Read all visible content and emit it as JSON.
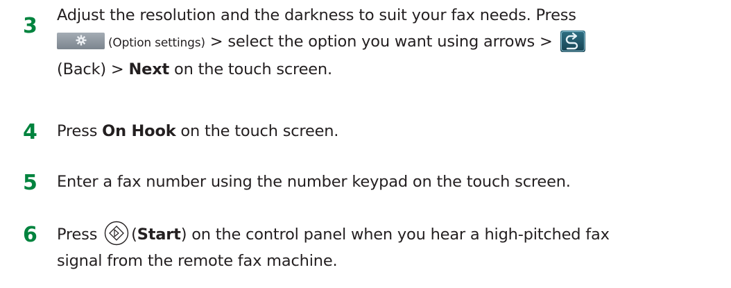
{
  "steps": [
    {
      "number": "3",
      "line1": "Adjust the resolution and the darkness to suit your fax needs. Press",
      "option_label": "(Option settings)",
      "line2_mid": " > select the option you want using arrows > ",
      "line3_pre": "(Back) > ",
      "next_label": "Next",
      "line3_post": " on the touch screen."
    },
    {
      "number": "4",
      "pre": "Press ",
      "bold": "On Hook",
      "post": " on the touch screen."
    },
    {
      "number": "5",
      "text": "Enter a fax number using the number keypad on the touch screen."
    },
    {
      "number": "6",
      "pre": "Press ",
      "paren_open": " (",
      "bold": "Start",
      "line1_post": ") on the control panel when you hear a high-pitched fax",
      "line2": "signal from the remote fax machine."
    }
  ],
  "icons": {
    "option_settings": "gear-icon",
    "back": "back-arrow-icon",
    "start": "start-diamond-icon"
  },
  "colors": {
    "step_number": "#00833e",
    "text": "#231f20"
  }
}
